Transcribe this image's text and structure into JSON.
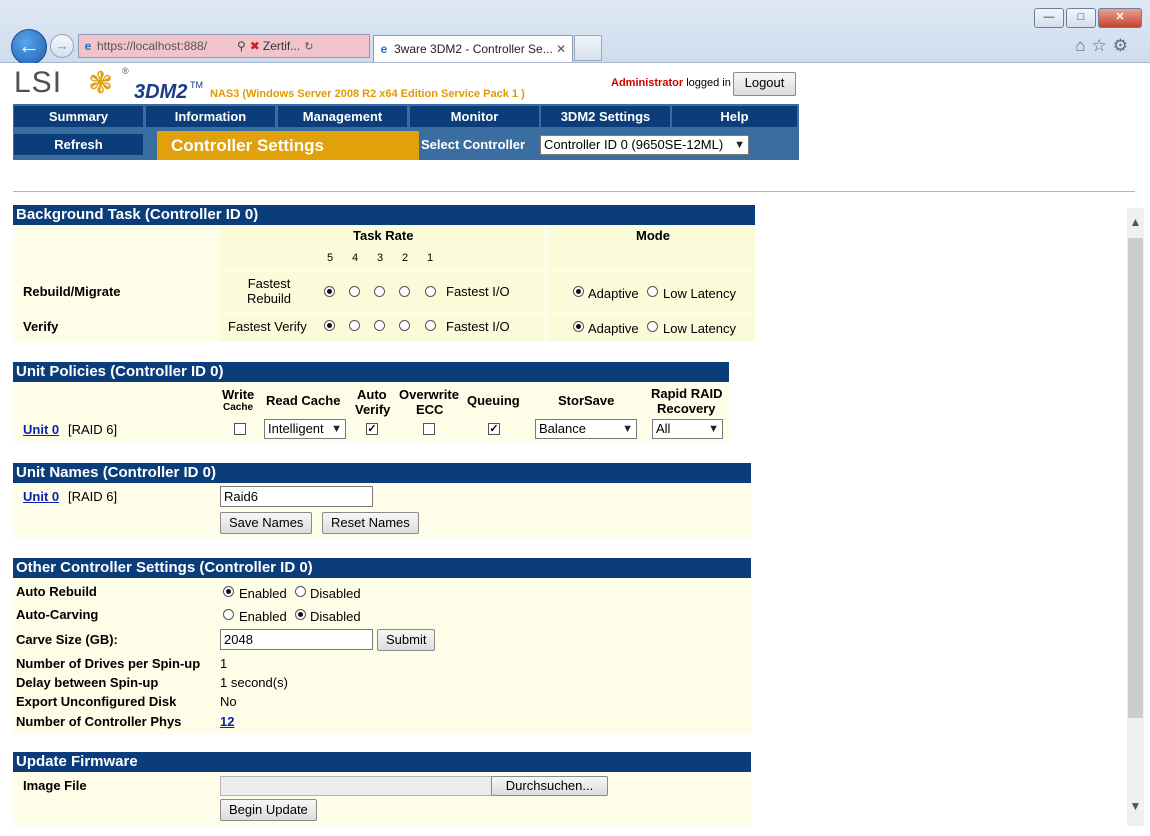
{
  "browser": {
    "address_url": "https://localhost:888/",
    "cert_label": "Zertif...",
    "tab_title": "3ware 3DM2 - Controller Se..."
  },
  "header": {
    "logo_text": "LSI",
    "product": "3DM2",
    "host_info": "NAS3 (Windows Server 2008 R2 x64 Edition Service Pack 1 )",
    "user": "Administrator",
    "logged_in": "logged in",
    "logout": "Logout"
  },
  "nav": {
    "items": [
      "Summary",
      "Information",
      "Management",
      "Monitor",
      "3DM2 Settings",
      "Help"
    ],
    "refresh": "Refresh",
    "page_title": "Controller Settings",
    "select_controller_label": "Select Controller",
    "select_controller_value": "Controller ID 0 (9650SE-12ML)"
  },
  "background_task": {
    "title": "Background Task (Controller ID 0)",
    "task_rate_header": "Task Rate",
    "mode_header": "Mode",
    "rates": [
      "5",
      "4",
      "3",
      "2",
      "1"
    ],
    "rows": [
      {
        "label": "Rebuild/Migrate",
        "left": "Fastest Rebuild",
        "right": "Fastest I/O",
        "selected_rate": "5",
        "mode": "Adaptive"
      },
      {
        "label": "Verify",
        "left": "Fastest Verify",
        "right": "Fastest I/O",
        "selected_rate": "5",
        "mode": "Adaptive"
      }
    ],
    "mode_options": [
      "Adaptive",
      "Low Latency"
    ]
  },
  "unit_policies": {
    "title": "Unit Policies (Controller ID 0)",
    "headers": {
      "write_cache": [
        "Write",
        "Cache"
      ],
      "read_cache": "Read Cache",
      "auto_verify": [
        "Auto",
        "Verify"
      ],
      "overwrite_ecc": [
        "Overwrite",
        "ECC"
      ],
      "queuing": "Queuing",
      "storsave": "StorSave",
      "rapid_raid": [
        "Rapid RAID",
        "Recovery"
      ]
    },
    "unit": {
      "link": "Unit 0",
      "raid": "[RAID 6]",
      "write_cache": false,
      "read_cache": "Intelligent",
      "auto_verify": true,
      "overwrite_ecc": false,
      "queuing": true,
      "storsave": "Balance",
      "rapid_raid": "All"
    }
  },
  "unit_names": {
    "title": "Unit Names (Controller ID 0)",
    "unit_link": "Unit 0",
    "raid": "[RAID 6]",
    "name_value": "Raid6",
    "save": "Save Names",
    "reset": "Reset Names"
  },
  "other_settings": {
    "title": "Other Controller Settings (Controller ID 0)",
    "auto_rebuild": {
      "label": "Auto Rebuild",
      "value": "Enabled"
    },
    "auto_carving": {
      "label": "Auto-Carving",
      "value": "Disabled"
    },
    "options": [
      "Enabled",
      "Disabled"
    ],
    "carve_size": {
      "label": "Carve Size (GB):",
      "value": "2048",
      "submit": "Submit"
    },
    "drives_per_spinup": {
      "label": "Number of Drives per Spin-up",
      "value": "1"
    },
    "delay_spinup": {
      "label": "Delay between Spin-up",
      "value": "1 second(s)"
    },
    "export_unconfigured": {
      "label": "Export Unconfigured Disk",
      "value": "No"
    },
    "controller_phys": {
      "label": "Number of Controller Phys",
      "value": "12"
    }
  },
  "update_firmware": {
    "title": "Update Firmware",
    "image_file_label": "Image File",
    "browse": "Durchsuchen...",
    "begin": "Begin Update"
  },
  "colors": {
    "nav_dark": "#0a3d7a",
    "nav_mid": "#3b6ea0",
    "accent": "#e0a10a",
    "section_bg": "#fdfde8"
  }
}
